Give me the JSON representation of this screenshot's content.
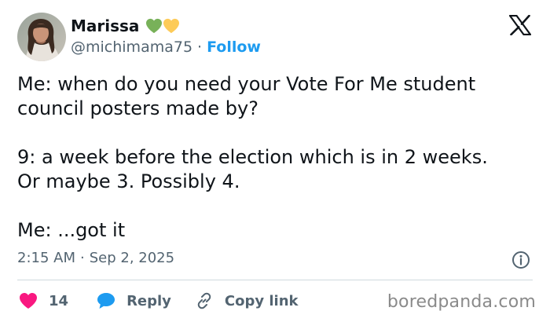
{
  "author": {
    "display_name": "Marissa",
    "emoji_icons": [
      "green-heart-icon",
      "yellow-heart-icon"
    ],
    "handle": "@michimama75",
    "separator": "·",
    "follow_label": "Follow"
  },
  "tweet": {
    "paragraphs": [
      {
        "lines": [
          "Me: when do you need your Vote For Me student",
          "council posters made by?"
        ]
      },
      {
        "lines": [
          "9: a week before the election which is in 2 weeks.",
          "Or maybe 3. Possibly 4."
        ]
      },
      {
        "lines": [
          "Me: ...got it"
        ]
      }
    ],
    "time": "2:15 AM",
    "date_separator": "·",
    "date": "Sep 2, 2025"
  },
  "actions": {
    "like_count": "14",
    "reply_label": "Reply",
    "copy_link_label": "Copy link"
  },
  "watermark": "boredpanda.com",
  "colors": {
    "text": "#0f1419",
    "secondary_text": "#536471",
    "link_blue": "#1d9bf0",
    "like_pink": "#f91880",
    "green_heart": "#78b159",
    "yellow_heart": "#fdcb58",
    "divider": "#cfd9de"
  },
  "icons": {
    "platform_logo": "x-logo-icon",
    "info": "info-icon",
    "like": "heart-icon",
    "reply": "speech-bubble-icon",
    "copy_link": "link-icon"
  }
}
